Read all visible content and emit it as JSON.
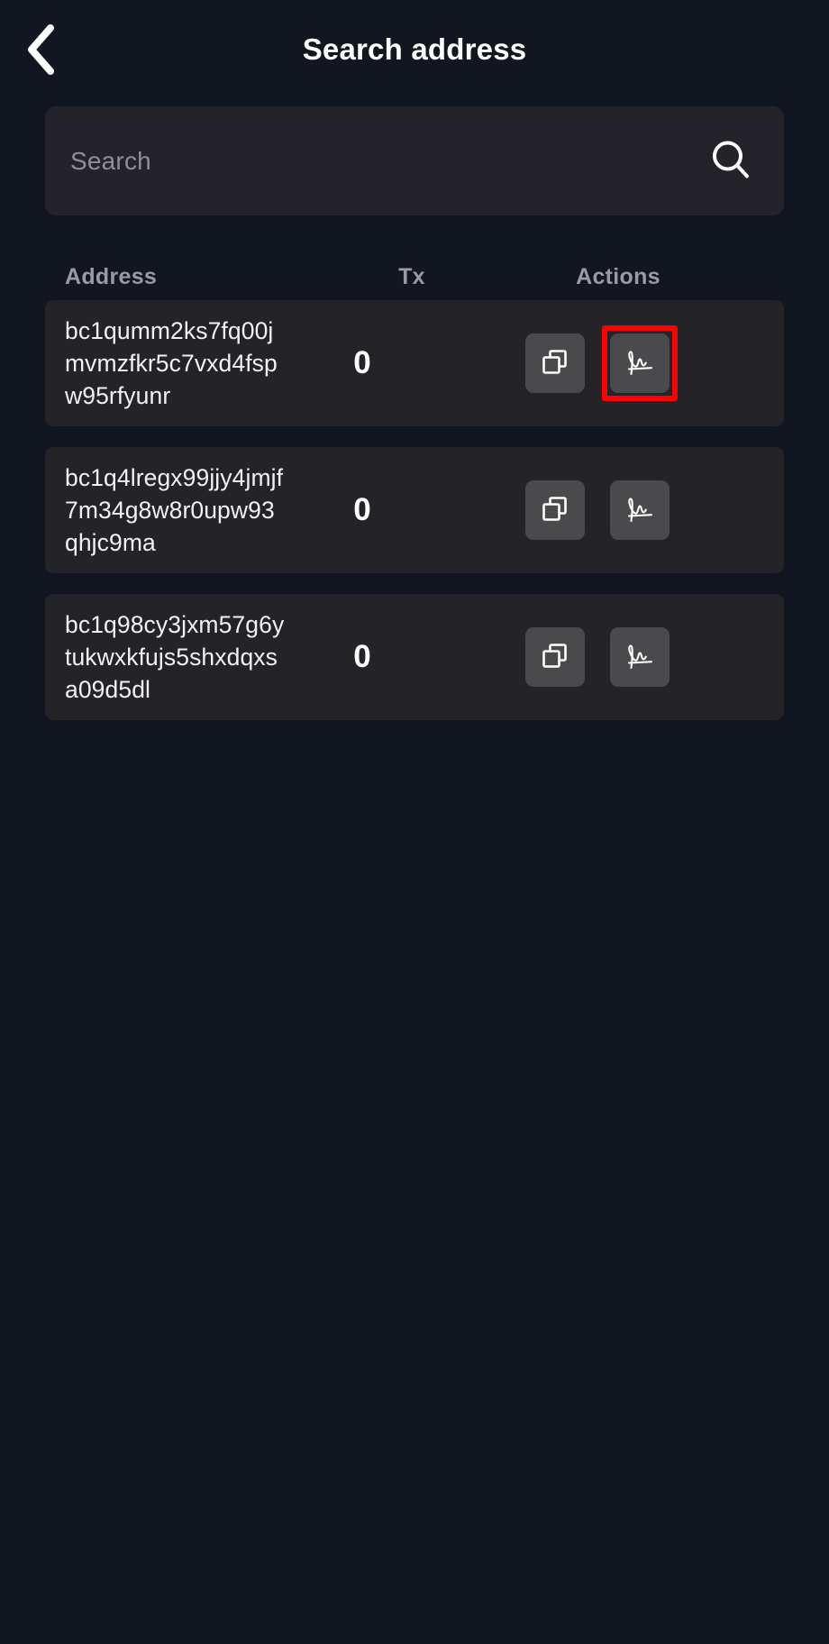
{
  "header": {
    "title": "Search address",
    "back_icon": "chevron-left-icon"
  },
  "search": {
    "placeholder": "Search",
    "value": "",
    "icon": "search-icon"
  },
  "table": {
    "columns": [
      "Address",
      "Tx",
      "Actions"
    ],
    "rows": [
      {
        "address": "bc1qumm2ks7fq00jmvmzfkr5c7vxd4fspw95rfyunr",
        "tx": "0",
        "actions": [
          "copy-icon",
          "signature-icon"
        ],
        "highlighted_action": "signature-icon"
      },
      {
        "address": "bc1q4lregx99jjy4jmjf7m34g8w8r0upw93qhjc9ma",
        "tx": "0",
        "actions": [
          "copy-icon",
          "signature-icon"
        ],
        "highlighted_action": null
      },
      {
        "address": "bc1q98cy3jxm57g6ytukwxkfujs5shxdqxsa09d5dl",
        "tx": "0",
        "actions": [
          "copy-icon",
          "signature-icon"
        ],
        "highlighted_action": null
      }
    ]
  },
  "colors": {
    "background": "#121620",
    "row_background": "#232328",
    "search_background": "#232329",
    "button_background": "#4a4a4d",
    "header_text": "#ffffff",
    "column_header_text": "#9a9aa2",
    "placeholder_text": "#8f8f96",
    "highlight": "#ff0000"
  }
}
